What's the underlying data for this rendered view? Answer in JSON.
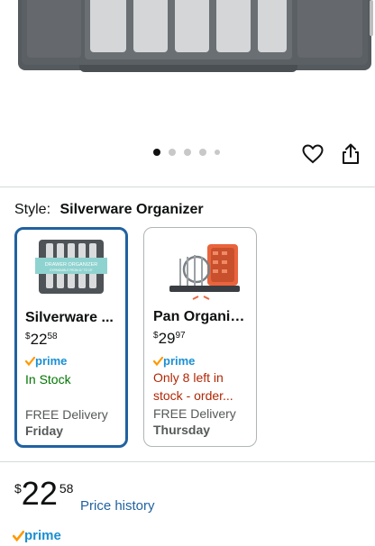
{
  "gallery": {
    "dot_count": 5,
    "active_index": 0
  },
  "style": {
    "label": "Style:",
    "selected": "Silverware Organizer"
  },
  "options": [
    {
      "title": "Silverware ...",
      "price_symbol": "$",
      "price_whole": "22",
      "price_fraction": "58",
      "prime": "prime",
      "stock": "In Stock",
      "delivery": "FREE Delivery",
      "day": "Friday",
      "image_text_1": "DRAWER ORGANIZER",
      "image_text_2": "EXPANDABLE FROM 11\" TO 19\"",
      "selected": true
    },
    {
      "title": "Pan Organizer",
      "price_symbol": "$",
      "price_whole": "29",
      "price_fraction": "97",
      "prime": "prime",
      "stock_line1": "Only 8 left in",
      "stock_line2": "stock - order...",
      "delivery": "FREE Delivery",
      "day": "Thursday",
      "selected": false
    }
  ],
  "buybox": {
    "price_symbol": "$",
    "price_whole": "22",
    "price_fraction": "58",
    "price_history": "Price history",
    "prime": "prime"
  },
  "colors": {
    "link": "#2162a1",
    "prime": "#1b8fd1",
    "in_stock": "#007600",
    "low_stock": "#b12704",
    "selected_border": "#2162a1"
  },
  "icons": [
    "heart-icon",
    "share-icon",
    "prime-check-icon"
  ]
}
